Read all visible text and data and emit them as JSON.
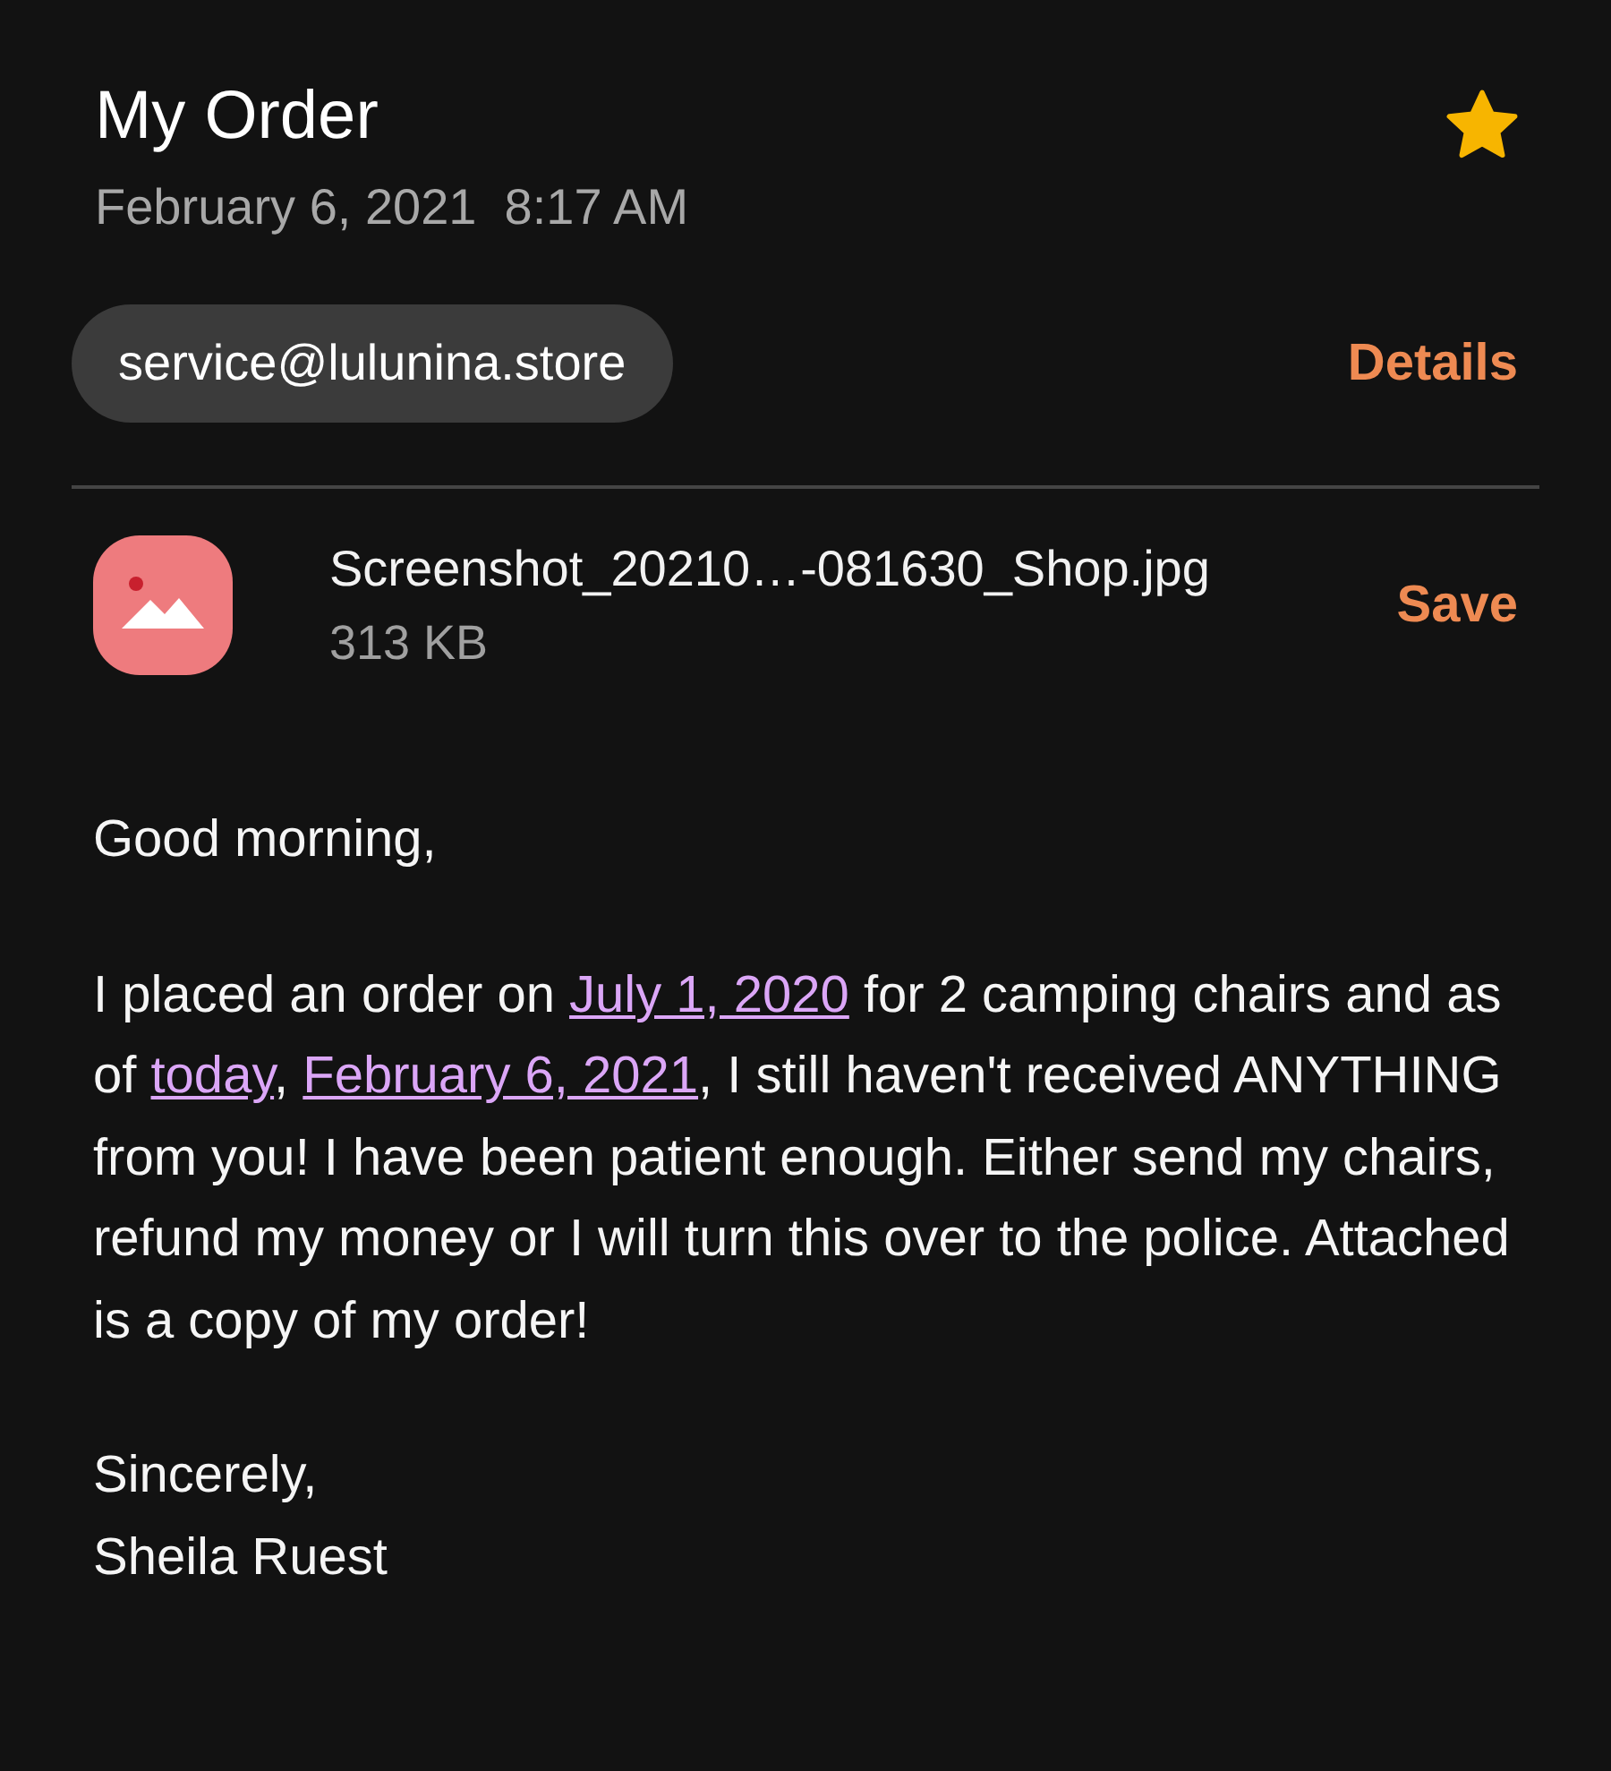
{
  "header": {
    "subject": "My Order",
    "starred": true,
    "date": "February 6, 2021  8:17 AM"
  },
  "sender": {
    "address": "service@lulunina.store",
    "details_label": "Details"
  },
  "attachment": {
    "file_name": "Screenshot_20210…-081630_Shop.jpg",
    "size": "313 KB",
    "save_label": "Save"
  },
  "body": {
    "greeting": "Good morning,",
    "paragraph": [
      {
        "kind": "text",
        "text": "I placed an order on "
      },
      {
        "kind": "link",
        "text": "July 1, 2020"
      },
      {
        "kind": "text",
        "text": " for 2 camping chairs and as of "
      },
      {
        "kind": "link",
        "text": "today"
      },
      {
        "kind": "text",
        "text": ", "
      },
      {
        "kind": "link",
        "text": "February 6, 2021"
      },
      {
        "kind": "text",
        "text": ", I still haven't received ANYTHING from you!  I have been patient enough. Either send my chairs, refund my money or I will turn this over to the police.  Attached is a copy of my order!"
      }
    ],
    "closing": "Sincerely,",
    "signature": "Sheila Ruest"
  }
}
